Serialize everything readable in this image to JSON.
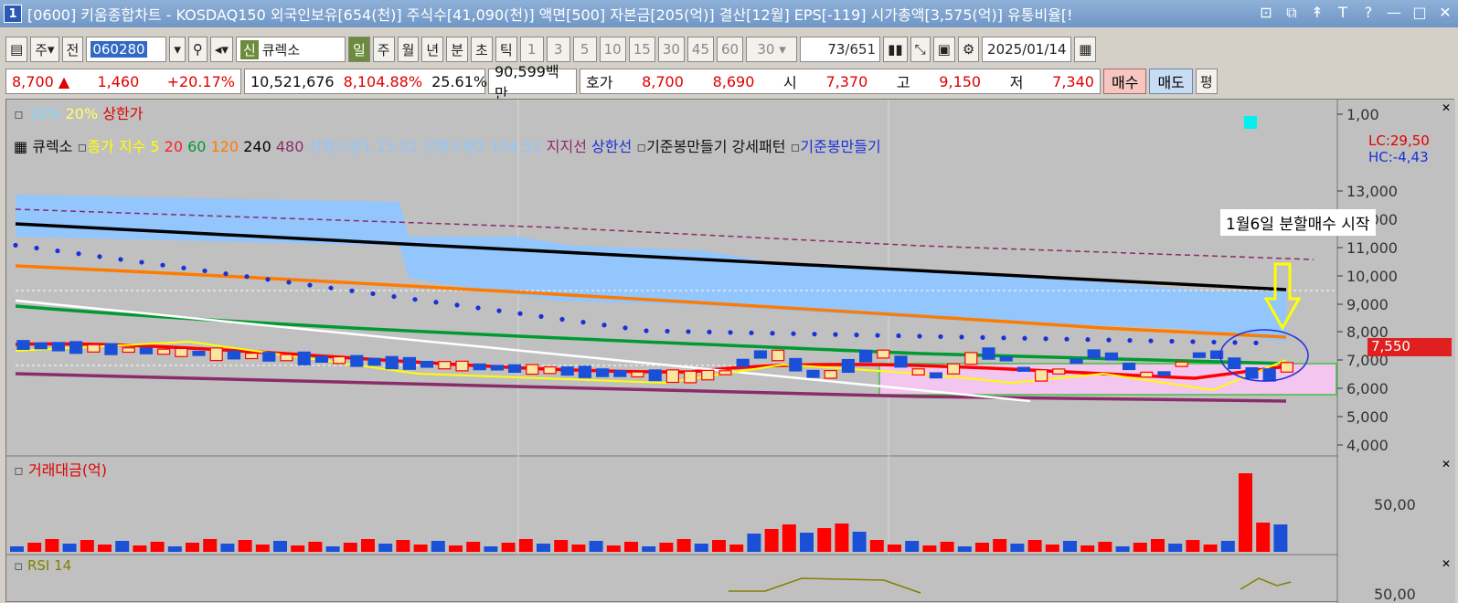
{
  "window": {
    "number": "1",
    "title": "[0600] 키움종합차트 - KOSDAQ150 외국인보유[654(천)] 주식수[41,090(천)] 액면[500] 자본금[205(억)] 결산[12월] EPS[-119] 시가총액[3,575(억)] 유통비율[!",
    "controls": [
      "⊡",
      "⧉",
      "↟",
      "T",
      "?",
      "—",
      "□",
      "✕"
    ]
  },
  "toolbar": {
    "type_label": "주",
    "prev_label": "전",
    "code": "060280",
    "market_badge": "신",
    "market": "큐렉소",
    "periods": [
      "일",
      "주",
      "월",
      "년",
      "분",
      "초",
      "틱"
    ],
    "active_period": "일",
    "intervals": [
      "1",
      "3",
      "5",
      "10",
      "15",
      "30",
      "45",
      "60"
    ],
    "interval_select": "30",
    "count": "73",
    "total": "/651",
    "date": "2025/01/14"
  },
  "quote": {
    "price": "8,700 ▲",
    "change": "1,460",
    "change_pct": "+20.17%",
    "volume": "10,521,676",
    "volume_pct": "8,104.88%",
    "turnover": "25.61%",
    "amount": "90,599백만",
    "hoga_label": "호가",
    "ask": "8,700",
    "bid": "8,690",
    "open_label": "시",
    "open": "7,370",
    "high_label": "고",
    "high": "9,150",
    "low_label": "저",
    "low": "7,340",
    "buy_button": "매수",
    "sell_button": "매도",
    "eval_button": "평"
  },
  "chart": {
    "top_legend": [
      "10%",
      "20%",
      "상한가"
    ],
    "legend": [
      "큐렉소",
      "종가 지수 5",
      "20",
      "60",
      "120",
      "240",
      "480",
      "선행스팬1 15,52",
      "선행스팬2 104,52",
      "지지선",
      "상한선",
      "기준봉만들기 강세패턴",
      "기준봉만들기"
    ],
    "price_ticks": [
      "1,00",
      "13,000",
      "12,000",
      "11,000",
      "10,000",
      "9,000",
      "8,000",
      "7,000",
      "6,000",
      "5,000",
      "4,000"
    ],
    "lc_label": "LC:29,50",
    "hc_label": "HC:-4,43",
    "last_price_tag": "7,550",
    "annotation": "1월6일 분할매수 시작",
    "volume_title": "거래대금(억)",
    "volume_tick": "50,00",
    "rsi_title": "RSI 14",
    "rsi_tick": "50,00"
  },
  "colors": {
    "bg": "#c0c0c0",
    "up": "#ff0000",
    "down": "#1a50d8",
    "ma5": "#ffff00",
    "ma20": "#ff0000",
    "ma60": "#009a30",
    "ma120": "#ff7a00",
    "ma240": "#000000",
    "ma480": "#8b2c6a",
    "cloud": "#8fc6ff"
  }
}
